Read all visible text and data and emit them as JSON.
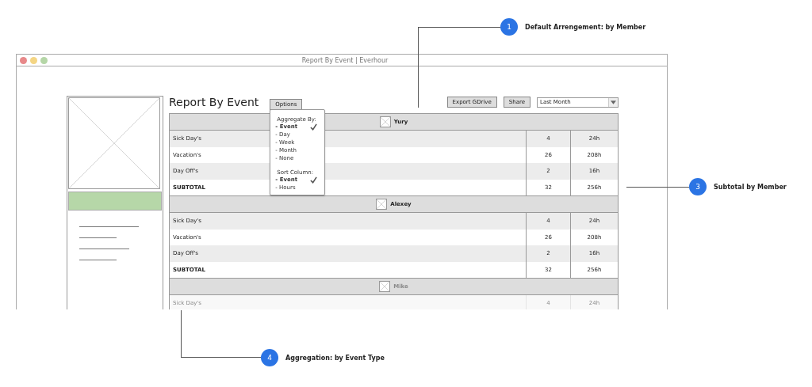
{
  "window": {
    "title": "Report By Event | Everhour"
  },
  "page": {
    "title": "Report By Event"
  },
  "toolbar": {
    "options_button": "Options",
    "export_button": "Export GDrive",
    "share_button": "Share",
    "period_select": {
      "value": "Last Month"
    }
  },
  "options_menu": {
    "sections": [
      {
        "heading": "Aggregate By:",
        "items": [
          {
            "label": "- Event",
            "checked": true
          },
          {
            "label": "- Day",
            "checked": false
          },
          {
            "label": "- Week",
            "checked": false
          },
          {
            "label": "- Month",
            "checked": false
          },
          {
            "label": "- None",
            "checked": false
          }
        ]
      },
      {
        "heading": "Sort Column:",
        "items": [
          {
            "label": "- Event",
            "checked": true
          },
          {
            "label": "- Hours",
            "checked": false
          }
        ]
      }
    ]
  },
  "groups": [
    {
      "member": "Yury",
      "faded": false,
      "rows": [
        {
          "kind": "event",
          "event": "Sick Day's",
          "count": "4",
          "hours": "24h"
        },
        {
          "kind": "event",
          "event": "Vacation's",
          "count": "26",
          "hours": "208h"
        },
        {
          "kind": "event",
          "event": "Day Off's",
          "count": "2",
          "hours": "16h"
        },
        {
          "kind": "subtotal",
          "event": "SUBTOTAL",
          "count": "32",
          "hours": "256h"
        }
      ]
    },
    {
      "member": "Alexey",
      "faded": false,
      "rows": [
        {
          "kind": "event",
          "event": "Sick Day's",
          "count": "4",
          "hours": "24h"
        },
        {
          "kind": "event",
          "event": "Vacation's",
          "count": "26",
          "hours": "208h"
        },
        {
          "kind": "event",
          "event": "Day Off's",
          "count": "2",
          "hours": "16h"
        },
        {
          "kind": "subtotal",
          "event": "SUBTOTAL",
          "count": "32",
          "hours": "256h"
        }
      ]
    },
    {
      "member": "Mike",
      "faded": true,
      "rows": [
        {
          "kind": "event",
          "event": "Sick Day's",
          "count": "4",
          "hours": "24h"
        }
      ]
    }
  ],
  "callouts": [
    {
      "number": "1",
      "text": "Default Arrengement: by Member"
    },
    {
      "number": "3",
      "text": "Subtotal by Member"
    },
    {
      "number": "4",
      "text": "Aggregation: by Event Type"
    }
  ]
}
